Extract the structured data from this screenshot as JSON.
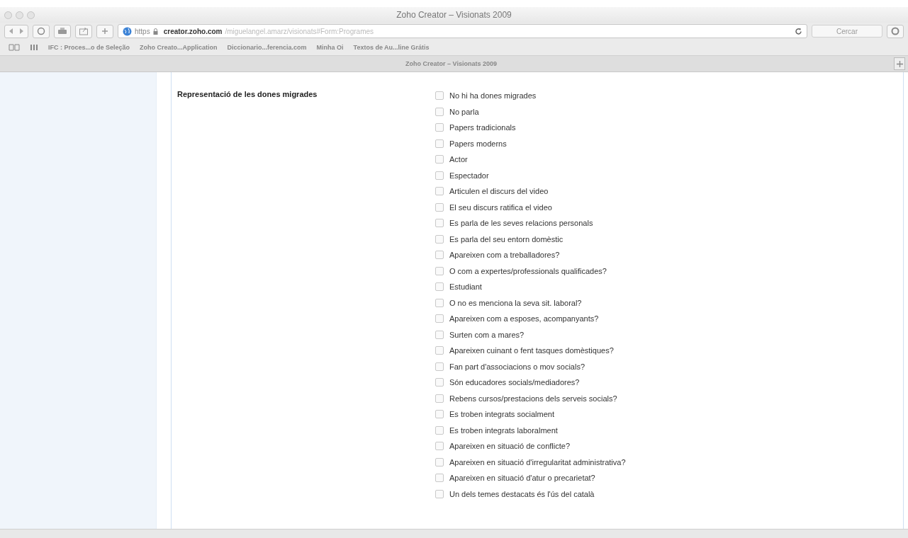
{
  "window": {
    "title": "Zoho Creator – Visionats 2009"
  },
  "toolbar": {
    "address": {
      "scheme": "https",
      "host": "creator.zoho.com",
      "path": "/miguelangel.amarz/visionats#Form:Programes"
    },
    "search": {
      "placeholder": "Cercar"
    }
  },
  "bookmarks": [
    "IFC : Proces...o de Seleção",
    "Zoho Creato...Application",
    "Diccionario...ferencia.com",
    "Minha Oi",
    "Textos de Au...line Grátis"
  ],
  "tab": {
    "title": "Zoho Creator – Visionats 2009"
  },
  "form": {
    "field_label": "Representació de les dones migrades",
    "options": [
      {
        "label": "No hi ha dones migrades",
        "checked": false
      },
      {
        "label": "No parla",
        "checked": false
      },
      {
        "label": "Papers tradicionals",
        "checked": false
      },
      {
        "label": "Papers moderns",
        "checked": false
      },
      {
        "label": "Actor",
        "checked": false
      },
      {
        "label": "Espectador",
        "checked": false
      },
      {
        "label": "Articulen el discurs del video",
        "checked": false
      },
      {
        "label": "El seu discurs ratifica el video",
        "checked": false
      },
      {
        "label": "Es parla de les seves relacions personals",
        "checked": false
      },
      {
        "label": "Es parla del seu entorn domèstic",
        "checked": false
      },
      {
        "label": "Apareixen com a treballadores?",
        "checked": false
      },
      {
        "label": "O com a expertes/professionals qualificades?",
        "checked": false
      },
      {
        "label": "Estudiant",
        "checked": false
      },
      {
        "label": "O no es menciona la seva sit. laboral?",
        "checked": false
      },
      {
        "label": "Apareixen com a esposes, acompanyants?",
        "checked": false
      },
      {
        "label": "Surten com a mares?",
        "checked": false
      },
      {
        "label": "Apareixen cuinant o fent tasques domèstiques?",
        "checked": false
      },
      {
        "label": "Fan part d'associacions o mov socials?",
        "checked": false
      },
      {
        "label": "Són educadores socials/mediadores?",
        "checked": false
      },
      {
        "label": "Rebens cursos/prestacions dels serveis socials?",
        "checked": false
      },
      {
        "label": "Es troben integrats socialment",
        "checked": false
      },
      {
        "label": "Es troben integrats laboralment",
        "checked": false
      },
      {
        "label": "Apareixen en situació de conflicte?",
        "checked": false
      },
      {
        "label": "Apareixen en situació d'irregularitat administrativa?",
        "checked": false
      },
      {
        "label": "Apareixen en situació d'atur o precarietat?",
        "checked": false
      },
      {
        "label": "Un dels temes destacats és l'ús del català",
        "checked": false
      }
    ]
  }
}
